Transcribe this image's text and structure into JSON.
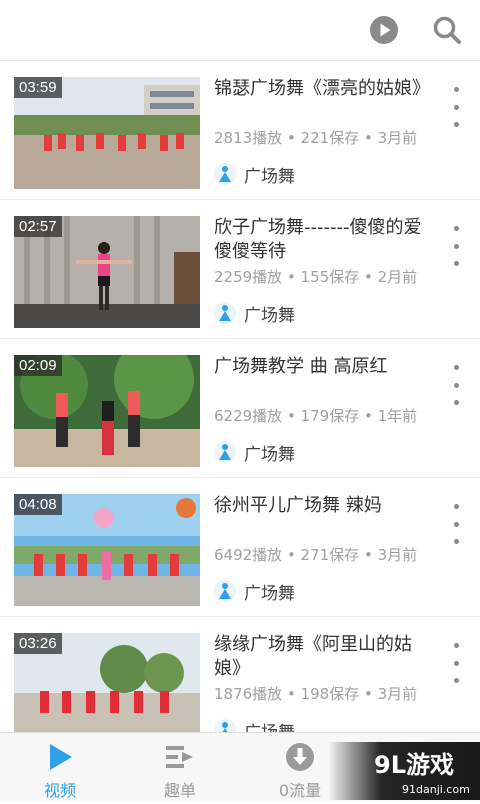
{
  "toolbar": {
    "play_icon": "play-circle-icon",
    "search_icon": "search-icon"
  },
  "videos": [
    {
      "duration": "03:59",
      "title": "锦瑟广场舞《漂亮的姑娘》",
      "meta": "2813播放 • 221保存 • 3月前",
      "channel": "广场舞"
    },
    {
      "duration": "02:57",
      "title": "欣子广场舞-------傻傻的爱傻傻等待",
      "meta": "2259播放 • 155保存 • 2月前",
      "channel": "广场舞"
    },
    {
      "duration": "02:09",
      "title": "广场舞教学 曲 高原红",
      "meta": "6229播放 • 179保存 • 1年前",
      "channel": "广场舞"
    },
    {
      "duration": "04:08",
      "title": "徐州平儿广场舞 辣妈",
      "meta": "6492播放 • 271保存 • 3月前",
      "channel": "广场舞"
    },
    {
      "duration": "03:26",
      "title": "缘缘广场舞《阿里山的姑娘》",
      "meta": "1876播放 • 198保存 • 3月前",
      "channel": "广场舞"
    }
  ],
  "tabs": [
    {
      "label": "视频",
      "active": true
    },
    {
      "label": "趣单",
      "active": false
    },
    {
      "label": "0流量",
      "active": false
    }
  ],
  "watermark": {
    "logo": "9L游戏",
    "url": "91danji.com"
  },
  "colors": {
    "accent": "#2fa0e8",
    "inactive": "#9a9a9a"
  }
}
